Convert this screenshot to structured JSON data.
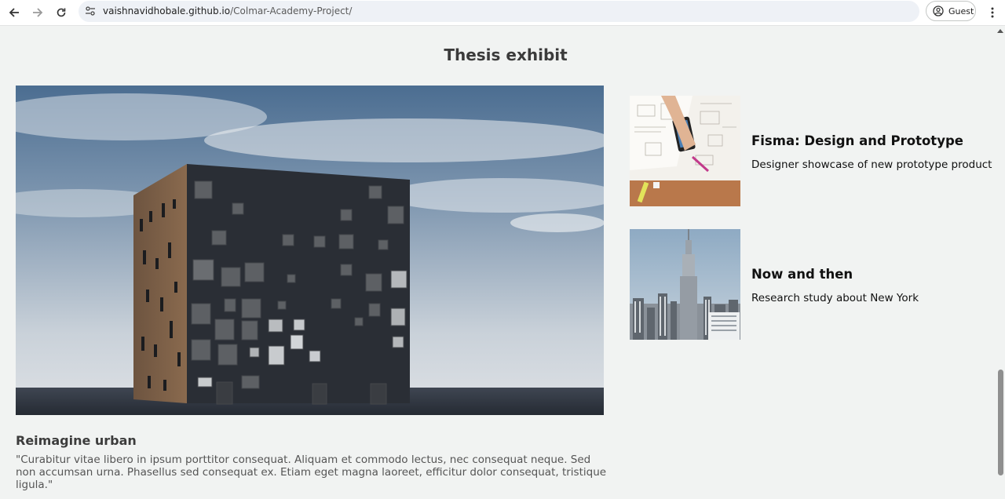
{
  "browser": {
    "url_host": "vaishnavidhobale.github.io",
    "url_path": "/Colmar-Academy-Project/",
    "profile_label": "Guest",
    "icons": [
      "back-arrow-icon",
      "forward-arrow-icon",
      "reload-icon",
      "site-info-icon",
      "profile-icon",
      "more-vert-icon"
    ]
  },
  "section": {
    "title": "Thesis exhibit"
  },
  "hero": {
    "title": "Reimagine urban",
    "description": "\"Curabitur vitae libero in ipsum porttitor consequat. Aliquam et commodo lectus, nec consequat neque. Sed non accumsan urna. Phasellus sed consequat ex. Etiam eget magna laoreet, efficitur dolor consequat, tristique ligula.\""
  },
  "cards": [
    {
      "title": "Fisma: Design and Prototype",
      "text": "Designer showcase of new prototype product"
    },
    {
      "title": "Now and then",
      "text": "Research study about New York"
    }
  ]
}
